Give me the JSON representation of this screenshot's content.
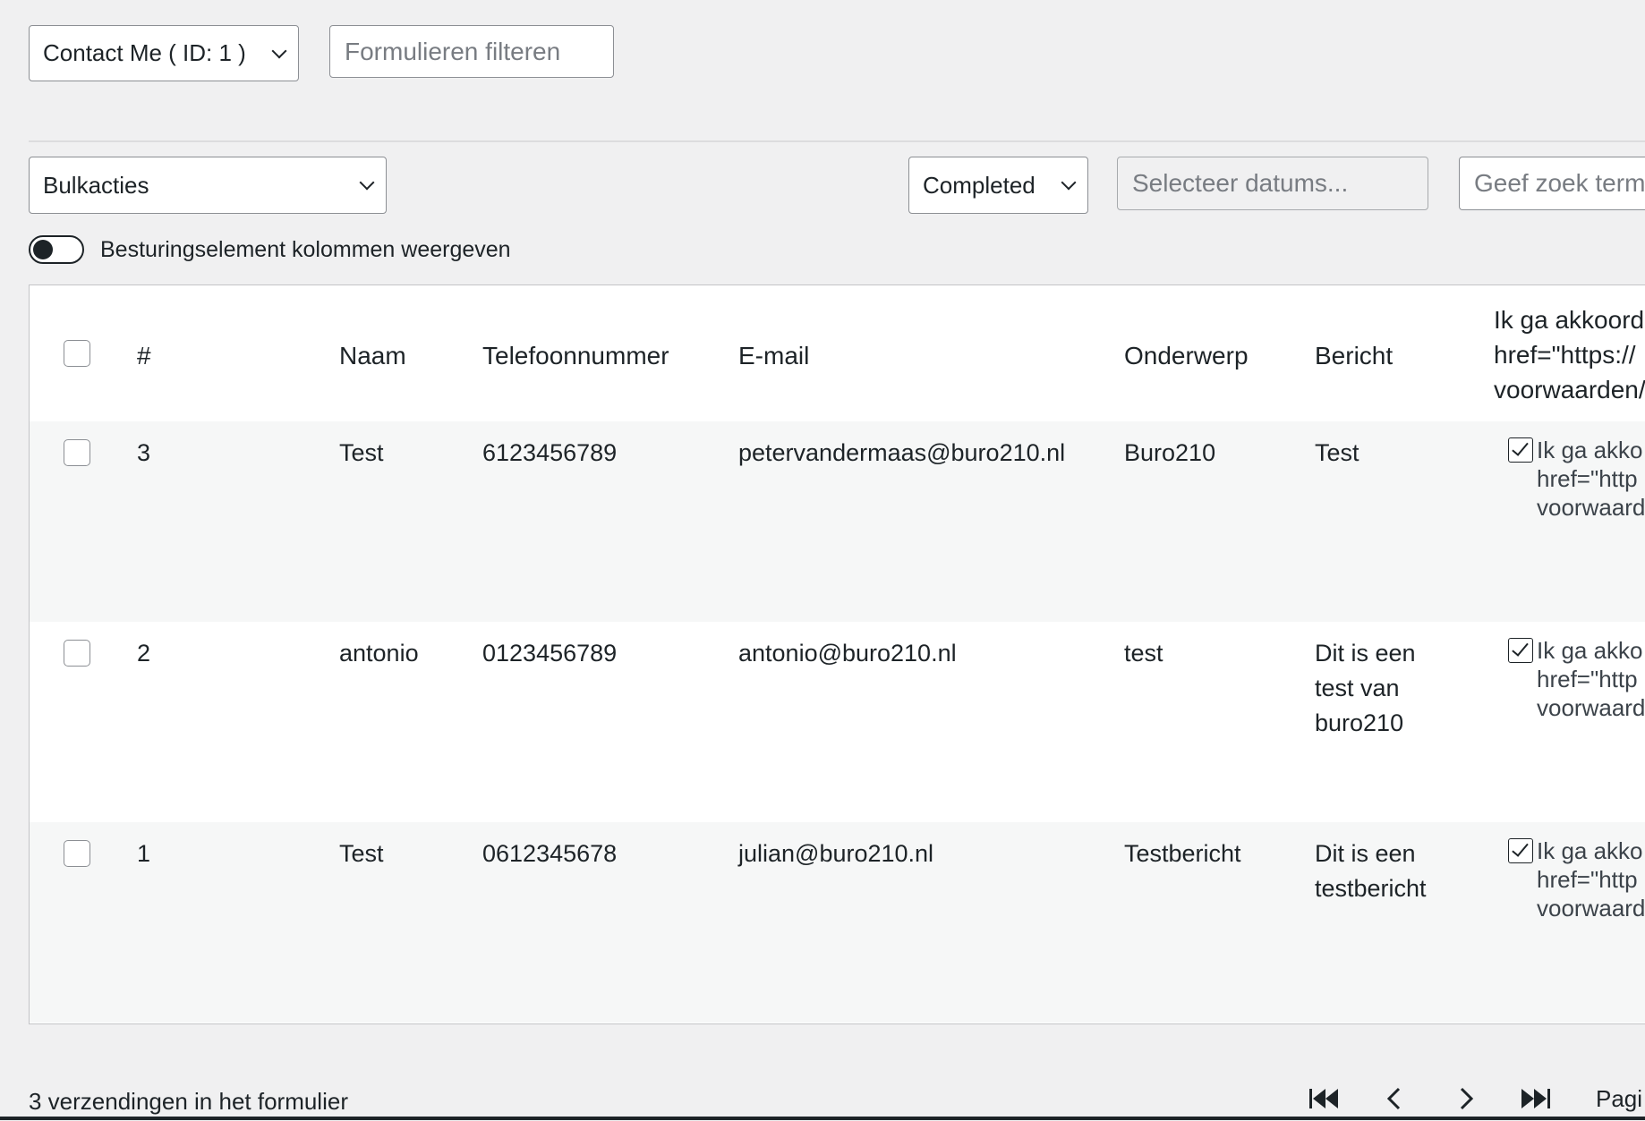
{
  "form_select": {
    "label": "Contact Me ( ID: 1 )"
  },
  "form_filter": {
    "placeholder": "Formulieren filteren"
  },
  "bulk_actions": {
    "label": "Bulkacties"
  },
  "status_select": {
    "label": "Completed"
  },
  "date_picker": {
    "placeholder": "Selecteer datums..."
  },
  "search": {
    "placeholder": "Geef zoek term"
  },
  "column_toggle": {
    "label": "Besturingselement kolommen weergeven",
    "enabled": false
  },
  "table": {
    "headers": {
      "id": "#",
      "name": "Naam",
      "phone": "Telefoonnummer",
      "email": "E-mail",
      "subject": "Onderwerp",
      "message": "Bericht",
      "agree": "Ik ga akkoord\nhref=\"https://\nvoorwaarden/"
    },
    "rows": [
      {
        "id": "3",
        "name": "Test",
        "phone": "6123456789",
        "email": "petervandermaas@buro210.nl",
        "subject": "Buro210",
        "message": "Test",
        "agree": "Ik ga akko\nhref=\"http\nvoorwaard"
      },
      {
        "id": "2",
        "name": "antonio",
        "phone": "0123456789",
        "email": "antonio@buro210.nl",
        "subject": "test",
        "message": "Dit is een\ntest van\nburo210",
        "agree": "Ik ga akko\nhref=\"http\nvoorwaard"
      },
      {
        "id": "1",
        "name": "Test",
        "phone": "0612345678",
        "email": "julian@buro210.nl",
        "subject": "Testbericht",
        "message": "Dit is een\ntestbericht",
        "agree": "Ik ga akko\nhref=\"http\nvoorwaard"
      }
    ]
  },
  "footer": {
    "count_text": "3 verzendingen in het formulier",
    "page_label": "Pagi"
  },
  "icons": [
    "chevron-down-icon",
    "first-page-icon",
    "prev-page-icon",
    "next-page-icon",
    "last-page-icon",
    "checkmark-icon"
  ]
}
